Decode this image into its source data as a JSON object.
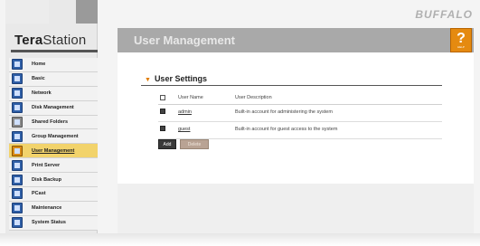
{
  "brand": {
    "name_bold": "Tera",
    "name_light": "Station",
    "vendor_logo": "BUFFALO"
  },
  "header": {
    "page_title": "User Management",
    "help_label": "?",
    "help_sub": "HELP"
  },
  "sidebar": {
    "items": [
      {
        "label": "Home",
        "icon": "home-icon"
      },
      {
        "label": "Basic",
        "icon": "basic-icon"
      },
      {
        "label": "Network",
        "icon": "network-icon"
      },
      {
        "label": "Disk Management",
        "icon": "disk-icon"
      },
      {
        "label": "Shared Folders",
        "icon": "folder-icon"
      },
      {
        "label": "Group Management",
        "icon": "group-icon"
      },
      {
        "label": "User Management",
        "icon": "user-icon",
        "active": true
      },
      {
        "label": "Print Server",
        "icon": "printer-icon"
      },
      {
        "label": "Disk Backup",
        "icon": "backup-icon"
      },
      {
        "label": "PCast",
        "icon": "pcast-icon"
      },
      {
        "label": "Maintenance",
        "icon": "maintenance-icon"
      },
      {
        "label": "System Status",
        "icon": "status-icon"
      }
    ]
  },
  "settings": {
    "title": "User Settings",
    "columns": {
      "name": "User Name",
      "description": "User Description"
    },
    "rows": [
      {
        "name": "admin",
        "description": "Built-in account for administering the system"
      },
      {
        "name": "guest",
        "description": "Built-in account for guest access to the system"
      }
    ],
    "add_label": "Add",
    "delete_label": "Delete"
  },
  "colors": {
    "accent": "#e58a10",
    "active_nav": "#f2d36b",
    "titlebar": "#a9a9a9"
  }
}
